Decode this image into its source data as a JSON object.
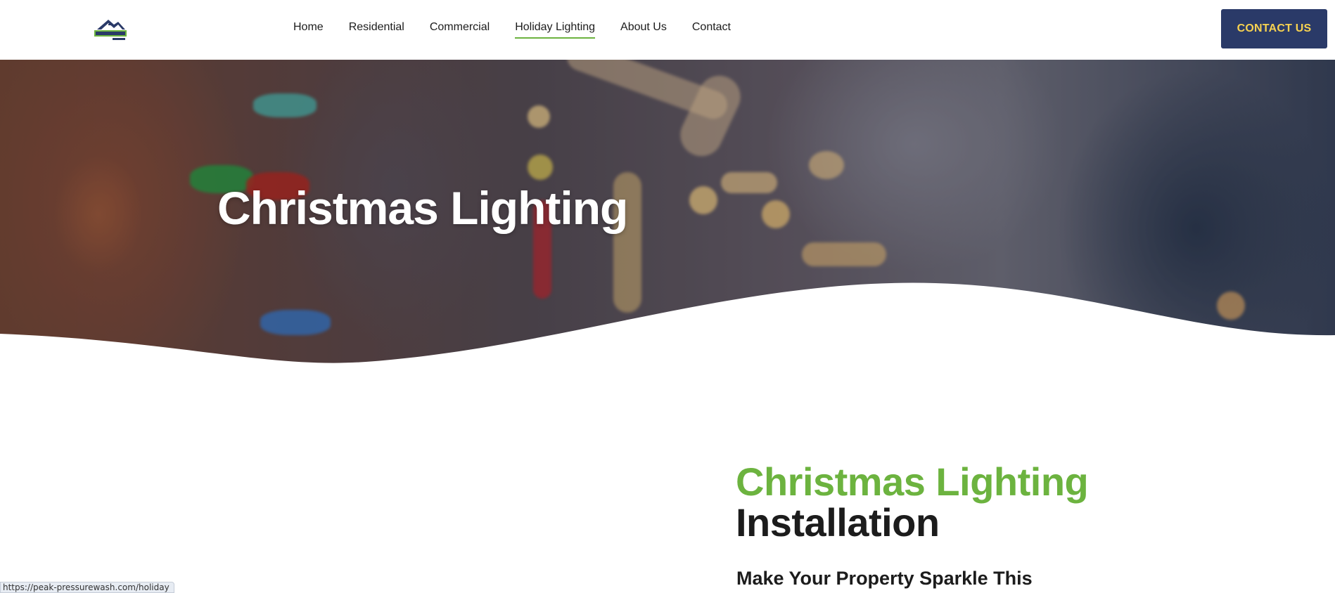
{
  "header": {
    "logo_alt": "Peak Pressure",
    "nav": [
      {
        "label": "Home"
      },
      {
        "label": "Residential"
      },
      {
        "label": "Commercial"
      },
      {
        "label": "Holiday Lighting",
        "active": true
      },
      {
        "label": "About Us"
      },
      {
        "label": "Contact"
      }
    ],
    "cta_label": "CONTACT US"
  },
  "hero": {
    "title": "Christmas Lighting"
  },
  "content": {
    "title_green": "Christmas Lighting",
    "title_dark": "Installation",
    "subheading": "Make Your Property Sparkle This"
  },
  "statusbar": {
    "url": "https://peak-pressurewash.com/holiday"
  },
  "colors": {
    "accent_green": "#6cb33f",
    "navy": "#2a3a68",
    "cta_text": "#f7d250"
  }
}
